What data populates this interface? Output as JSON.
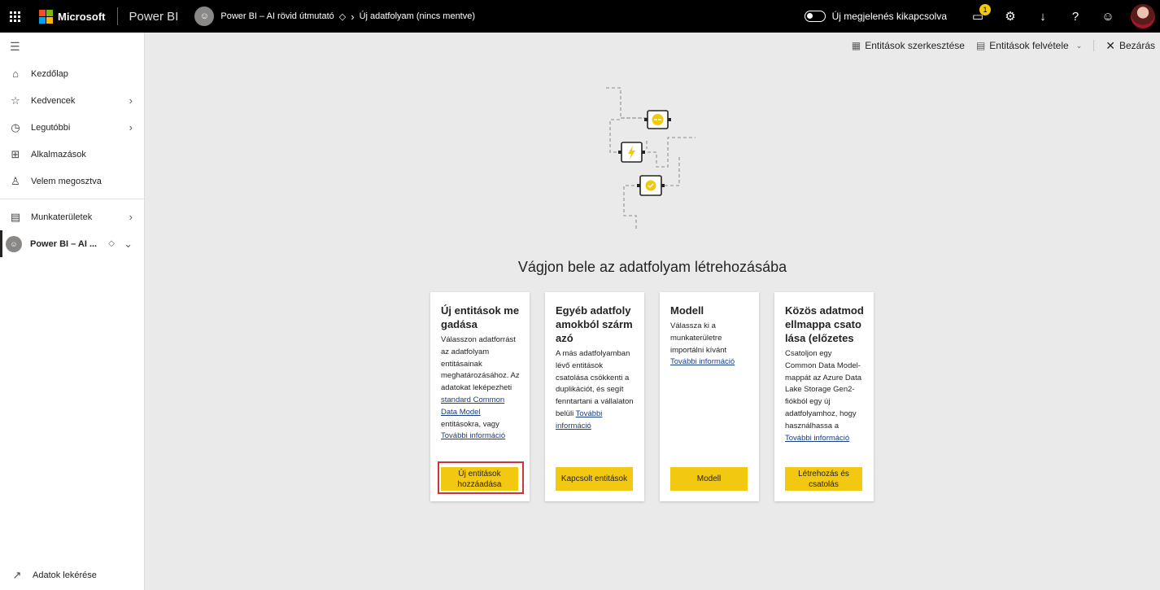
{
  "topbar": {
    "brand": "Microsoft",
    "product": "Power BI",
    "workspace": "Power BI – AI rövid útmutató",
    "page": "Új adatfolyam (nincs mentve)",
    "toggle_label": "Új megjelenés kikapcsolva",
    "notification_count": "1"
  },
  "sidebar": {
    "items": [
      {
        "label": "Kezdőlap",
        "icon": "home-icon"
      },
      {
        "label": "Kedvencek",
        "icon": "star-icon"
      },
      {
        "label": "Legutóbbi",
        "icon": "clock-icon"
      },
      {
        "label": "Alkalmazások",
        "icon": "apps-icon"
      },
      {
        "label": "Velem megosztva",
        "icon": "shared-icon"
      }
    ],
    "workspaces_label": "Munkaterületek",
    "current_workspace": "Power BI – AI ...",
    "get_data": "Adatok lekérése"
  },
  "commands": {
    "edit_entities": "Entitások szerkesztése",
    "add_entities": "Entitások felvétele",
    "close": "Bezárás"
  },
  "main": {
    "headline": "Vágjon bele az adatfolyam létrehozásába",
    "cards": [
      {
        "title": "Új entitások megadása",
        "text": "Válasszon adatforrást az adatfolyam entitásainak meghatározásához. Az adatokat leképezheti ",
        "link1": "standard Common Data Model",
        "text2": " entitásokra, vagy ",
        "more": "További információ",
        "button": "Új entitások hozzáadása"
      },
      {
        "title": "Egyéb adatfolyamokból származó",
        "text": "A más adatfolyamban lévő entitások csatolása csökkenti a duplikációt, és segít fenntartani a vállalaton belüli ",
        "more": "További információ",
        "button": "Kapcsolt entitások"
      },
      {
        "title": "Modell",
        "text": "Válassza ki a munkaterületre importálni kívánt ",
        "more": "További információ",
        "button": "Modell"
      },
      {
        "title": "Közös adatmodellmappa csatolása (előzetes",
        "text": "Csatoljon egy Common Data Model-mappát az Azure Data Lake Storage Gen2-fiókból egy új adatfolyamhoz, hogy használhassa a ",
        "more": "További információ",
        "button": "Létrehozás és csatolás"
      }
    ]
  },
  "colors": {
    "accent": "#f2c811",
    "link": "#1a3f86",
    "focus": "#d13438"
  }
}
